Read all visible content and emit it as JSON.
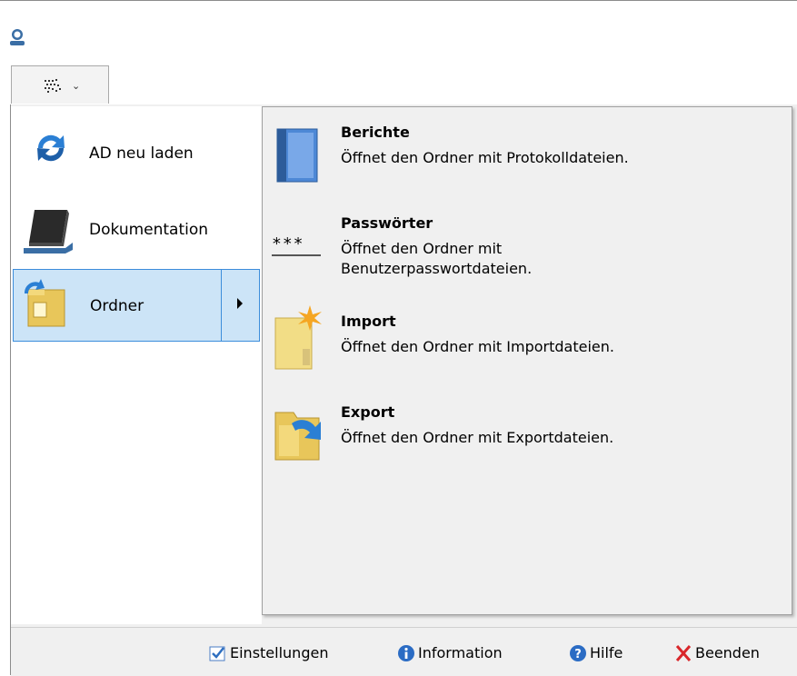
{
  "app_menu": {
    "button_icon": "grid-icon",
    "left_items": [
      {
        "label": "AD neu laden",
        "icon": "refresh-arrows-icon"
      },
      {
        "label": "Dokumentation",
        "icon": "book-icon"
      },
      {
        "label": "Ordner",
        "icon": "folder-open-icon"
      }
    ],
    "submenu": [
      {
        "title": "Berichte",
        "desc": "Öffnet den Ordner mit Protokolldateien.",
        "icon": "report-book-icon"
      },
      {
        "title": "Passwörter",
        "desc": "Öffnet den Ordner mit Benutzerpasswortdateien.",
        "icon": "password-icon",
        "icon_text": "***"
      },
      {
        "title": "Import",
        "desc": "Öffnet den Ordner mit Importdateien.",
        "icon": "import-icon"
      },
      {
        "title": "Export",
        "desc": "Öffnet den Ordner mit Exportdateien.",
        "icon": "export-icon"
      }
    ]
  },
  "footer": {
    "settings": "Einstellungen",
    "information": "Information",
    "help": "Hilfe",
    "exit": "Beenden"
  },
  "colors": {
    "selection_bg": "#cce4f7",
    "selection_border": "#3c8ddb",
    "menu_bg": "#f0f0f0"
  }
}
